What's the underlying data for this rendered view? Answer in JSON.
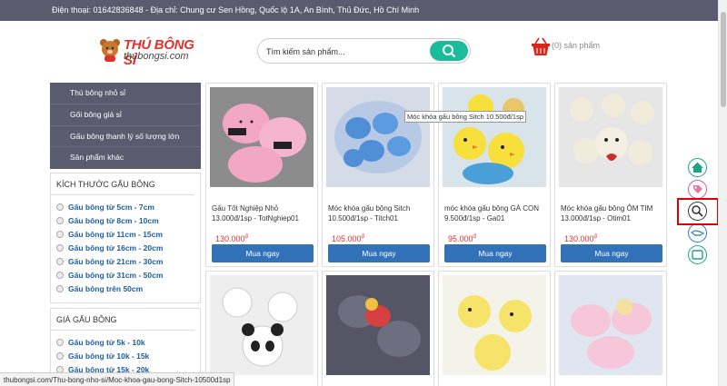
{
  "topbar": {
    "text": "Điện thoại: 01642836848 - Địa chỉ: Chung cư Sen Hồng, Quốc lộ 1A, An Bình, Thủ Đức, Hồ Chí Minh"
  },
  "logo": {
    "name": "THÚ BÔNG SỈ",
    "domain": "thubongsi.com"
  },
  "search": {
    "placeholder": "Tìm kiếm sản phẩm..."
  },
  "cart": {
    "label": "(0) sản phẩm"
  },
  "nav": [
    "Thú bông nhỏ sỉ",
    "Gối bông giá sỉ",
    "Gấu bông thanh lý số lượng lớn",
    "Sản phẩm khác"
  ],
  "size_filter": {
    "title": "KÍCH THƯỚC GẤU BÔNG",
    "items": [
      "Gấu bông từ 5cm - 7cm",
      "Gấu bông từ 8cm - 10cm",
      "Gấu bông từ 11cm - 15cm",
      "Gấu bông từ 16cm - 20cm",
      "Gấu bông từ 21cm - 30cm",
      "Gấu bông từ 31cm - 50cm",
      "Gấu bông trên 50cm"
    ]
  },
  "price_filter": {
    "title": "GIÁ GẤU BÔNG",
    "items": [
      "Gấu bông từ 5k - 10k",
      "Gấu bông từ 10k - 15k",
      "Gấu bông từ 15k - 20k"
    ]
  },
  "products": [
    {
      "name": "Gấu Tốt Nghiệp Nhỏ",
      "code": "13.000đ/1sp - TotNghiep01",
      "price": "130.000",
      "currency": "đ",
      "buy": "Mua ngay",
      "colors": [
        "#f2a7c3",
        "#333333"
      ]
    },
    {
      "name": "Móc khóa gấu bông Sitch",
      "code": "10.500đ/1sp - Titch01",
      "price": "105.000",
      "currency": "đ",
      "buy": "Mua ngay",
      "colors": [
        "#6fa8dc",
        "#c9d8ef"
      ]
    },
    {
      "name": "móc khóa gấu bông GÀ CON",
      "code": "9.500đ/1sp - Ga01",
      "price": "95.000",
      "currency": "đ",
      "buy": "Mua ngay",
      "colors": [
        "#f7e03c",
        "#4a9fd8"
      ]
    },
    {
      "name": "Móc khóa gấu bông ÔM TIM",
      "code": "13.000đ/1sp - Otim01",
      "price": "130.000",
      "currency": "đ",
      "buy": "Mua ngay",
      "colors": [
        "#f1ebdc",
        "#c9302c"
      ]
    },
    {
      "colors": [
        "#ffffff",
        "#222222"
      ]
    },
    {
      "colors": [
        "#555566",
        "#d64040"
      ]
    },
    {
      "colors": [
        "#f6e36a",
        "#eeeeee"
      ]
    },
    {
      "colors": [
        "#f5c7d8",
        "#e0e6f0"
      ]
    }
  ],
  "tooltip": "Móc khóa gấu bông Sitch 10.500đ/1sp",
  "status_bar": "thubongsi.com/Thu-bong-nho-si/Moc-khoa-gau-bong-Sitch-10500d1sp",
  "floating_icons": [
    "home-icon",
    "tag-icon",
    "search-icon",
    "handshake-icon",
    "screen-icon"
  ],
  "colors": {
    "accent": "#1abc9c",
    "topbar": "#5a5b6e",
    "button": "#3272b8",
    "price": "#e0322d",
    "highlight": "#e00000"
  }
}
